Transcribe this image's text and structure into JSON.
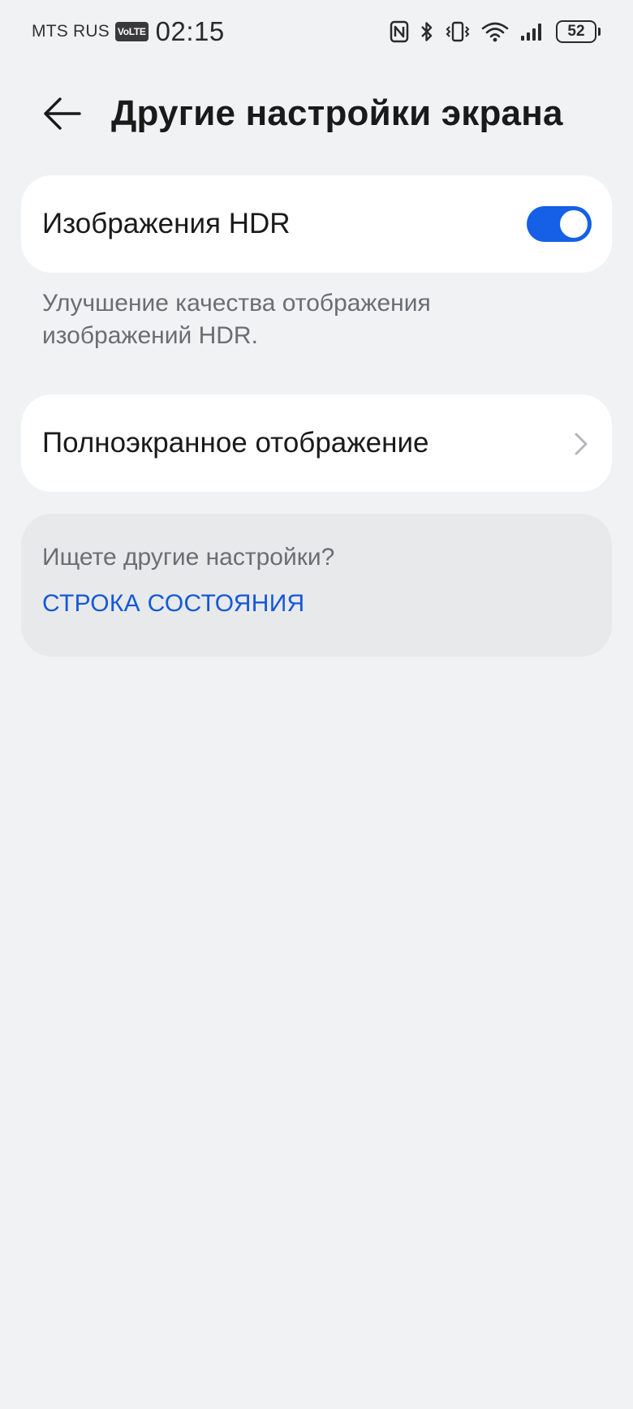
{
  "status_bar": {
    "carrier": "MTS RUS",
    "volte_badge": "VoLTE",
    "time": "02:15",
    "icons": [
      "nfc-icon",
      "bluetooth-icon",
      "vibrate-icon",
      "wifi-icon",
      "signal-icon",
      "battery-icon"
    ],
    "battery_level": "52"
  },
  "header": {
    "back_icon": "arrow-left-icon",
    "title": "Другие настройки экрана"
  },
  "settings": {
    "hdr": {
      "label": "Изображения HDR",
      "enabled": true,
      "description": "Улучшение качества отображения изображений HDR."
    },
    "fullscreen": {
      "label": "Полноэкранное отображение",
      "icon": "chevron-right-icon"
    }
  },
  "suggestions": {
    "question": "Ищете другие настройки?",
    "link": "СТРОКА СОСТОЯНИЯ"
  },
  "colors": {
    "background": "#f1f2f4",
    "accent": "#1560e6",
    "link": "#1459d6",
    "card": "#ffffff",
    "secondary_text": "#6b6d72"
  }
}
